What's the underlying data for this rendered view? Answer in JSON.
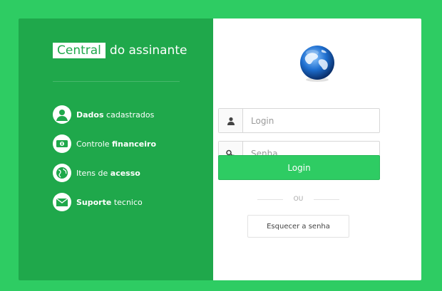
{
  "brand": {
    "highlight": "Central",
    "rest": "do assinante"
  },
  "features": [
    {
      "bold": "Dados",
      "text": " cadastrados",
      "icon": "user-icon"
    },
    {
      "text": "Controle ",
      "bold": "financeiro",
      "icon": "money-icon"
    },
    {
      "text": "Itens de ",
      "bold": "acesso",
      "icon": "globe-icon"
    },
    {
      "bold": "Suporte",
      "text": " tecnico",
      "icon": "envelope-icon"
    }
  ],
  "form": {
    "login_placeholder": "Login",
    "password_placeholder": "Senha",
    "login_button": "Login",
    "or_text": "OU",
    "forgot_button": "Esquecer a senha"
  },
  "colors": {
    "page_bg": "#2ecc63",
    "left_panel": "#1fa84b",
    "button": "#2ecc63"
  }
}
